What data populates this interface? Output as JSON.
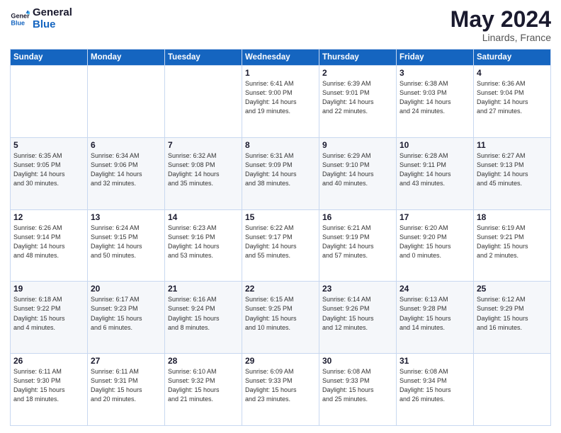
{
  "logo": {
    "line1": "General",
    "line2": "Blue"
  },
  "title": "May 2024",
  "subtitle": "Linards, France",
  "days_header": [
    "Sunday",
    "Monday",
    "Tuesday",
    "Wednesday",
    "Thursday",
    "Friday",
    "Saturday"
  ],
  "weeks": [
    [
      {
        "day": "",
        "info": ""
      },
      {
        "day": "",
        "info": ""
      },
      {
        "day": "",
        "info": ""
      },
      {
        "day": "1",
        "info": "Sunrise: 6:41 AM\nSunset: 9:00 PM\nDaylight: 14 hours\nand 19 minutes."
      },
      {
        "day": "2",
        "info": "Sunrise: 6:39 AM\nSunset: 9:01 PM\nDaylight: 14 hours\nand 22 minutes."
      },
      {
        "day": "3",
        "info": "Sunrise: 6:38 AM\nSunset: 9:03 PM\nDaylight: 14 hours\nand 24 minutes."
      },
      {
        "day": "4",
        "info": "Sunrise: 6:36 AM\nSunset: 9:04 PM\nDaylight: 14 hours\nand 27 minutes."
      }
    ],
    [
      {
        "day": "5",
        "info": "Sunrise: 6:35 AM\nSunset: 9:05 PM\nDaylight: 14 hours\nand 30 minutes."
      },
      {
        "day": "6",
        "info": "Sunrise: 6:34 AM\nSunset: 9:06 PM\nDaylight: 14 hours\nand 32 minutes."
      },
      {
        "day": "7",
        "info": "Sunrise: 6:32 AM\nSunset: 9:08 PM\nDaylight: 14 hours\nand 35 minutes."
      },
      {
        "day": "8",
        "info": "Sunrise: 6:31 AM\nSunset: 9:09 PM\nDaylight: 14 hours\nand 38 minutes."
      },
      {
        "day": "9",
        "info": "Sunrise: 6:29 AM\nSunset: 9:10 PM\nDaylight: 14 hours\nand 40 minutes."
      },
      {
        "day": "10",
        "info": "Sunrise: 6:28 AM\nSunset: 9:11 PM\nDaylight: 14 hours\nand 43 minutes."
      },
      {
        "day": "11",
        "info": "Sunrise: 6:27 AM\nSunset: 9:13 PM\nDaylight: 14 hours\nand 45 minutes."
      }
    ],
    [
      {
        "day": "12",
        "info": "Sunrise: 6:26 AM\nSunset: 9:14 PM\nDaylight: 14 hours\nand 48 minutes."
      },
      {
        "day": "13",
        "info": "Sunrise: 6:24 AM\nSunset: 9:15 PM\nDaylight: 14 hours\nand 50 minutes."
      },
      {
        "day": "14",
        "info": "Sunrise: 6:23 AM\nSunset: 9:16 PM\nDaylight: 14 hours\nand 53 minutes."
      },
      {
        "day": "15",
        "info": "Sunrise: 6:22 AM\nSunset: 9:17 PM\nDaylight: 14 hours\nand 55 minutes."
      },
      {
        "day": "16",
        "info": "Sunrise: 6:21 AM\nSunset: 9:19 PM\nDaylight: 14 hours\nand 57 minutes."
      },
      {
        "day": "17",
        "info": "Sunrise: 6:20 AM\nSunset: 9:20 PM\nDaylight: 15 hours\nand 0 minutes."
      },
      {
        "day": "18",
        "info": "Sunrise: 6:19 AM\nSunset: 9:21 PM\nDaylight: 15 hours\nand 2 minutes."
      }
    ],
    [
      {
        "day": "19",
        "info": "Sunrise: 6:18 AM\nSunset: 9:22 PM\nDaylight: 15 hours\nand 4 minutes."
      },
      {
        "day": "20",
        "info": "Sunrise: 6:17 AM\nSunset: 9:23 PM\nDaylight: 15 hours\nand 6 minutes."
      },
      {
        "day": "21",
        "info": "Sunrise: 6:16 AM\nSunset: 9:24 PM\nDaylight: 15 hours\nand 8 minutes."
      },
      {
        "day": "22",
        "info": "Sunrise: 6:15 AM\nSunset: 9:25 PM\nDaylight: 15 hours\nand 10 minutes."
      },
      {
        "day": "23",
        "info": "Sunrise: 6:14 AM\nSunset: 9:26 PM\nDaylight: 15 hours\nand 12 minutes."
      },
      {
        "day": "24",
        "info": "Sunrise: 6:13 AM\nSunset: 9:28 PM\nDaylight: 15 hours\nand 14 minutes."
      },
      {
        "day": "25",
        "info": "Sunrise: 6:12 AM\nSunset: 9:29 PM\nDaylight: 15 hours\nand 16 minutes."
      }
    ],
    [
      {
        "day": "26",
        "info": "Sunrise: 6:11 AM\nSunset: 9:30 PM\nDaylight: 15 hours\nand 18 minutes."
      },
      {
        "day": "27",
        "info": "Sunrise: 6:11 AM\nSunset: 9:31 PM\nDaylight: 15 hours\nand 20 minutes."
      },
      {
        "day": "28",
        "info": "Sunrise: 6:10 AM\nSunset: 9:32 PM\nDaylight: 15 hours\nand 21 minutes."
      },
      {
        "day": "29",
        "info": "Sunrise: 6:09 AM\nSunset: 9:33 PM\nDaylight: 15 hours\nand 23 minutes."
      },
      {
        "day": "30",
        "info": "Sunrise: 6:08 AM\nSunset: 9:33 PM\nDaylight: 15 hours\nand 25 minutes."
      },
      {
        "day": "31",
        "info": "Sunrise: 6:08 AM\nSunset: 9:34 PM\nDaylight: 15 hours\nand 26 minutes."
      },
      {
        "day": "",
        "info": ""
      }
    ]
  ]
}
